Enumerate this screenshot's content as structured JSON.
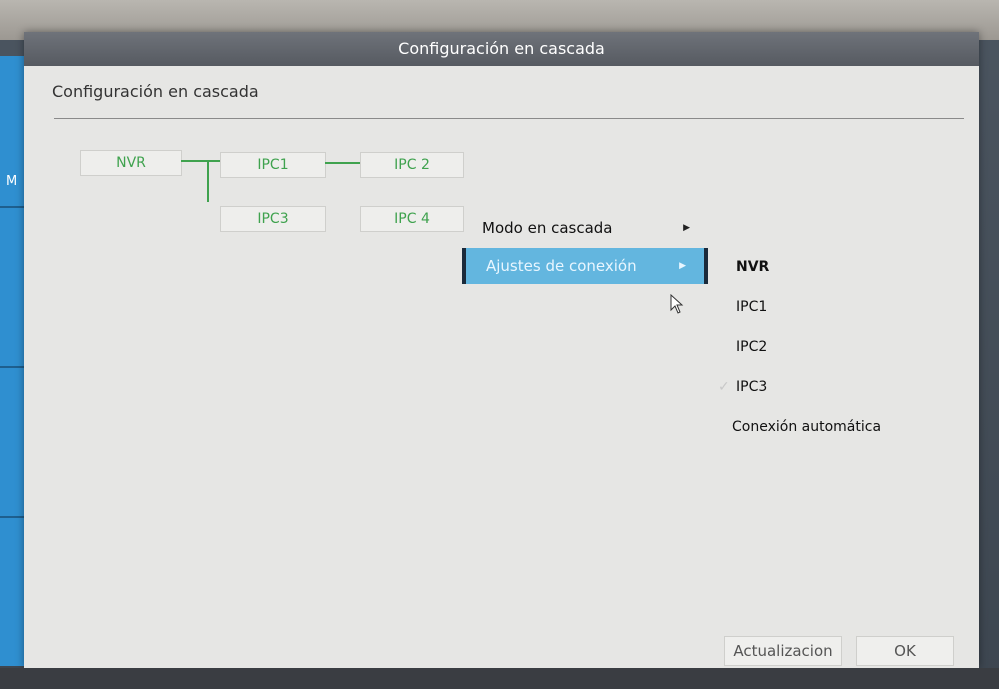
{
  "background": {
    "left_label": "M"
  },
  "dialog": {
    "title": "Configuración en cascada",
    "subtitle": "Configuración en cascada"
  },
  "topology": {
    "nodes": [
      "NVR",
      "IPC1",
      "IPC 2",
      "IPC3",
      "IPC 4"
    ],
    "line_color": "#3fa24e"
  },
  "context_menu": {
    "items": [
      {
        "label": "Modo en cascada",
        "has_submenu": true
      },
      {
        "label": "Ajustes de conexión",
        "has_submenu": true,
        "active": true
      }
    ],
    "arrow_icon": "caret-right-icon"
  },
  "submenu": {
    "items": [
      {
        "label": "NVR",
        "checked": false,
        "bold": true
      },
      {
        "label": "IPC1",
        "checked": false
      },
      {
        "label": "IPC2",
        "checked": false
      },
      {
        "label": "IPC3",
        "checked": true
      },
      {
        "label": "Conexión automática",
        "checked": false
      }
    ]
  },
  "buttons": {
    "update": "Actualizacion",
    "ok": "OK"
  },
  "colors": {
    "highlight": "#63b6df",
    "accent_green": "#3fa24e",
    "titlebar": "#5f636a"
  }
}
